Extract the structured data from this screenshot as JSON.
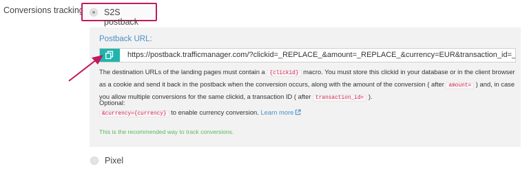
{
  "conversions": {
    "label": "Conversions tracking",
    "options": [
      {
        "label": "S2S postback",
        "selected": true
      },
      {
        "label": "Pixel",
        "selected": false
      }
    ]
  },
  "postback": {
    "label": "Postback URL:",
    "url": "https://postback.trafficmanager.com/?clickid=_REPLACE_&amount=_REPLACE_&currency=EUR&transaction_id=_",
    "copy_icon": "copy-icon"
  },
  "description": {
    "p1": "The destination URLs of the landing pages must contain a ",
    "code_clickid": "{clickid}",
    "p2": " macro. You must store this clickid in your database or in the client browser as a cookie and send it back in the postback when the conversion occurs, along with the amount of the conversion ( after ",
    "code_amount": "amount=",
    "p3": " ) and, in case you allow multiple conversions for the same clickid, a transaction ID ( after ",
    "code_transaction": "transaction_id=",
    "p4": " )."
  },
  "optional": {
    "label": "Optional:",
    "code": "&currency={currency}",
    "text": " to enable currency conversion. ",
    "learn_more": "Learn more"
  },
  "recommendation": "This is the recommended way to track conversions.",
  "colors": {
    "highlight_border": "#c2185b",
    "arrow": "#c2185b",
    "copy_button": "#1fb5ad",
    "link": "#4a90c8",
    "recommend_text": "#5cb85c",
    "code_text": "#c7254e"
  }
}
